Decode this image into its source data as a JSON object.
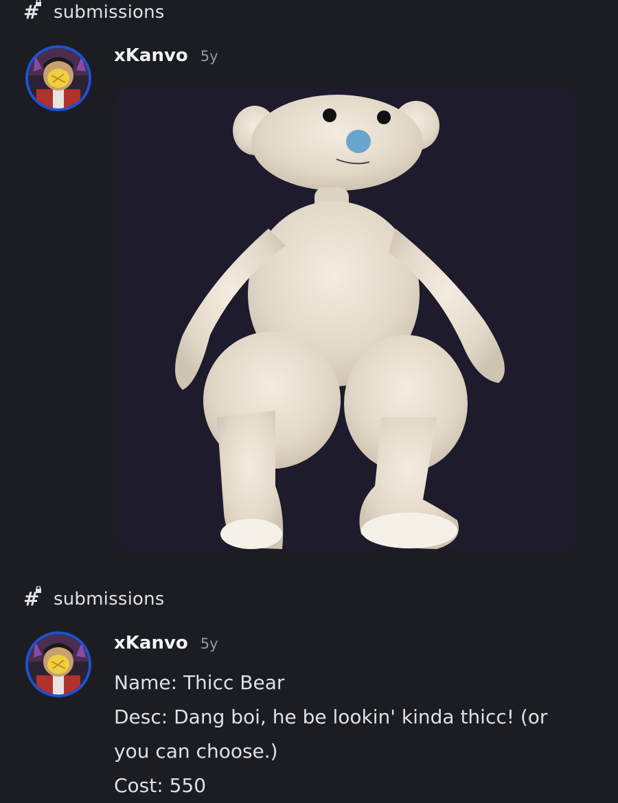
{
  "channel": {
    "name": "submissions",
    "icon": "locked-hash-icon"
  },
  "messages": [
    {
      "author": "xKanvo",
      "timestamp": "5y",
      "avatar": "user-avatar",
      "attachment": "image-attachment"
    },
    {
      "author": "xKanvo",
      "timestamp": "5y",
      "avatar": "user-avatar",
      "lines": [
        "Name: Thicc Bear",
        "Desc: Dang boi, he be lookin' kinda thicc! (or",
        "you can choose.)",
        "Cost: 550"
      ]
    }
  ],
  "colors": {
    "background": "#1c1d22",
    "avatar_ring": "#1c52d6",
    "attachment_bg": "#1d1b2c"
  }
}
